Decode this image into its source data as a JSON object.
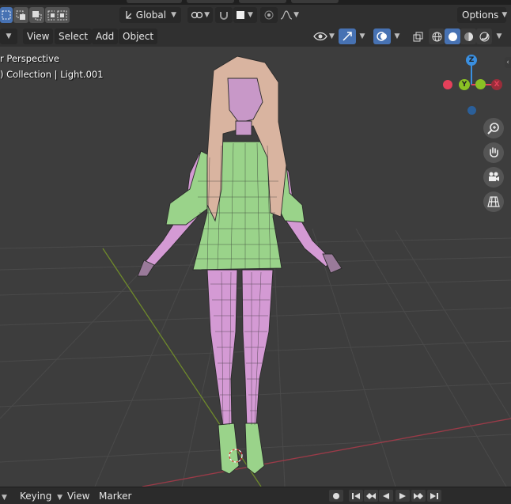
{
  "toolbar": {
    "orientation_label": "Global",
    "options_label": "Options"
  },
  "menubar": {
    "items": [
      "View",
      "Select",
      "Add",
      "Object"
    ]
  },
  "viewport": {
    "perspective_label": "r Perspective",
    "collection_label": ") Collection | Light.001",
    "gizmo": {
      "z": "Z",
      "y": "Y",
      "x": "X"
    }
  },
  "timeline": {
    "items": [
      "Keying",
      "View",
      "Marker"
    ]
  },
  "colors": {
    "accent": "#4772b3",
    "axis_x": "#e5405a",
    "axis_y": "#8ac124",
    "axis_z": "#3a8fe0",
    "mesh_green": "#9ad38a",
    "mesh_pink": "#d49ad4",
    "hair": "#d9b4a0"
  }
}
